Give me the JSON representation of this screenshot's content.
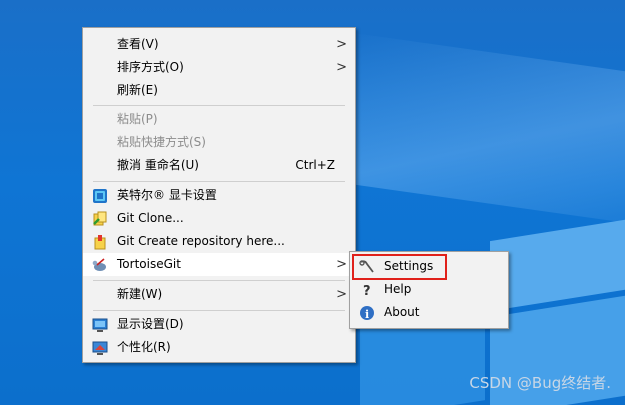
{
  "context_menu": {
    "items": [
      {
        "label": "查看(V)",
        "has_submenu": true
      },
      {
        "label": "排序方式(O)",
        "has_submenu": true
      },
      {
        "label": "刷新(E)"
      },
      {
        "label": "粘贴(P)",
        "disabled": true
      },
      {
        "label": "粘贴快捷方式(S)",
        "disabled": true
      },
      {
        "label": "撤消 重命名(U)",
        "shortcut": "Ctrl+Z"
      },
      {
        "label": "英特尔® 显卡设置",
        "icon": "intel-graphics-icon"
      },
      {
        "label": "Git Clone...",
        "icon": "git-clone-icon"
      },
      {
        "label": "Git Create repository here...",
        "icon": "git-create-repo-icon"
      },
      {
        "label": "TortoiseGit",
        "icon": "tortoisegit-icon",
        "has_submenu": true,
        "highlighted": true
      },
      {
        "label": "新建(W)",
        "has_submenu": true
      },
      {
        "label": "显示设置(D)",
        "icon": "display-settings-icon"
      },
      {
        "label": "个性化(R)",
        "icon": "personalize-icon"
      }
    ]
  },
  "tortoisegit_submenu": {
    "items": [
      {
        "label": "Settings",
        "icon": "settings-wrench-icon",
        "outlined": true
      },
      {
        "label": "Help",
        "icon": "help-icon"
      },
      {
        "label": "About",
        "icon": "about-info-icon"
      }
    ]
  },
  "arrow_glyph": ">",
  "watermark": "CSDN @Bug终结者.",
  "colors": {
    "desktop": "#1077d6",
    "menu_bg": "#f2f2f2",
    "highlight_outline": "#e0211b",
    "disabled_text": "#8c8c8c"
  }
}
